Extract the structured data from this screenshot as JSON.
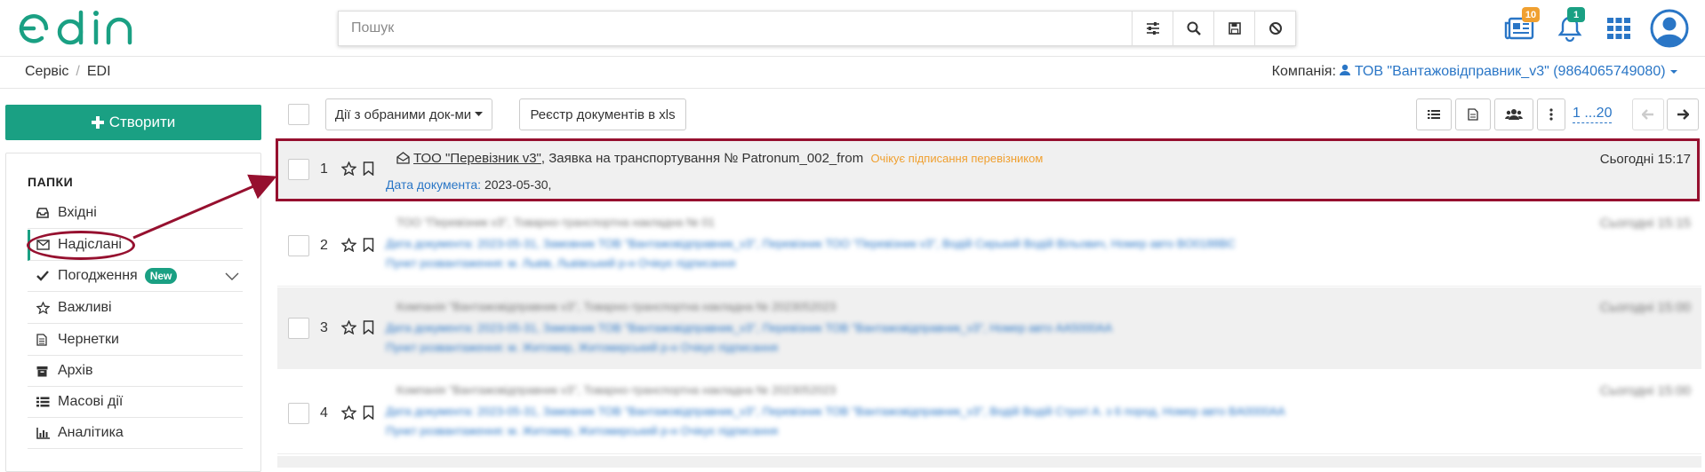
{
  "header": {
    "logo_text": "edin",
    "search_placeholder": "Пошук",
    "news_badge": "10",
    "notifications_badge": "1",
    "colors": {
      "brand": "#1aa083",
      "link": "#2a76c6",
      "accent_warn": "#f0a030",
      "annotation": "#96102f"
    }
  },
  "breadcrumb": {
    "service": "Сервіс",
    "sep": "/",
    "current": "EDI"
  },
  "company": {
    "label": "Компанія:",
    "name": "ТОВ \"Вантажовідправник_v3\" (9864065749080)"
  },
  "sidebar": {
    "create_label": "Створити",
    "folders_title": "ПАПКИ",
    "items": [
      {
        "label": "Вхідні",
        "icon": "inbox-icon"
      },
      {
        "label": "Надіслані",
        "icon": "envelope-icon"
      },
      {
        "label": "Погодження",
        "icon": "check-icon",
        "badge": "New"
      },
      {
        "label": "Важливі",
        "icon": "star-icon"
      },
      {
        "label": "Чернетки",
        "icon": "file-icon"
      },
      {
        "label": "Архів",
        "icon": "archive-icon"
      },
      {
        "label": "Масові дії",
        "icon": "list-icon"
      },
      {
        "label": "Аналітика",
        "icon": "chart-icon"
      }
    ]
  },
  "toolbar": {
    "bulk_actions_label": "Дії з обраними док-ми",
    "registry_label": "Реєстр документів в xls",
    "pager_label": "1 ...20"
  },
  "documents": [
    {
      "num": "1",
      "sender": "ТОО \"Перевізник v3\"",
      "title": ", Заявка на транспортування № Patronum_002_from",
      "status": "Очікує підписання перевізником",
      "date_label": "Дата документа:",
      "date_value": "2023-05-30,",
      "time": "Сьогодні 15:17"
    },
    {
      "num": "2",
      "sender": "ТОО \"Перевізник v3\"",
      "title": ", Товарно-транспортна накладна № 01",
      "time": "Сьогодні 15:15",
      "line2": "Дата документа: 2023-05-31, Замовник ТОВ \"Вантажовідправник_v3\", Перевізник ТОО \"Перевізник v3\", Водій Сирький Водій Вільович, Номер авто BO0188BC",
      "line3": "Пункт розвантаження: м. Львів, Львівський р-н Очікує підписання"
    },
    {
      "num": "3",
      "sender": "Компанія \"Вантажовідправник v3\"",
      "title": ", Товарно-транспортна накладна № 2023052023",
      "time": "Сьогодні 15:00",
      "line2": "Дата документа: 2023-05-31, Замовник ТОВ \"Вантажовідправник_v3\", Перевізник ТОВ \"Вантажовідправник_v3\", Номер авто AA5000AA",
      "line3": "Пункт розвантаження: м. Житомир, Житомирський р-н Очікує підписання"
    },
    {
      "num": "4",
      "sender": "Компанія \"Вантажовідправник v3\"",
      "title": ", Товарно-транспортна накладна № 2023052023",
      "time": "Сьогодні 15:00",
      "line2": "Дата документа: 2023-05-31, Замовник ТОВ \"Вантажовідправник_v3\", Перевізник ТОВ \"Вантажовідправник_v3\", Водій Водій Строгі А. з 6 пород, Номер авто BA0000AA",
      "line3": "Пункт розвантаження: м. Житомир, Житомирський р-н Очікує підписання"
    }
  ]
}
